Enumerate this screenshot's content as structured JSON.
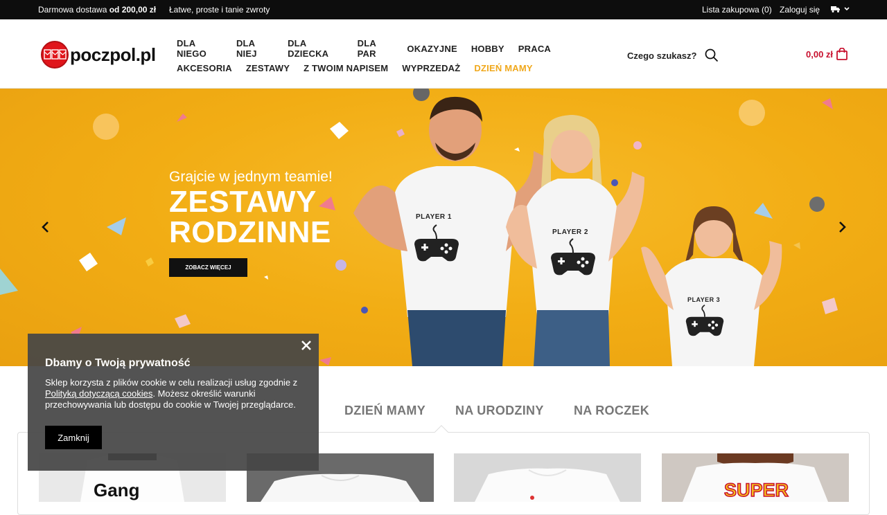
{
  "topbar": {
    "shipping_prefix": "Darmowa dostawa ",
    "shipping_amount": "od 200,00 zł",
    "returns": "Łatwe, proste i tanie zwroty",
    "wishlist": "Lista zakupowa (0)",
    "login": "Zaloguj się",
    "shipping_icon": "truck-icon"
  },
  "header": {
    "logo_text": "poczpol.pl",
    "search_label": "Czego szukasz?",
    "cart_total": "0,00 zł"
  },
  "nav": {
    "row1": [
      "DLA NIEGO",
      "DLA NIEJ",
      "DLA DZIECKA",
      "DLA PAR",
      "OKAZYJNE",
      "HOBBY",
      "PRACA"
    ],
    "row2": [
      "AKCESORIA",
      "ZESTAWY",
      "Z TWOIM NAPISEM",
      "WYPRZEDAŻ",
      "DZIEŃ MAMY"
    ]
  },
  "hero": {
    "subtitle": "Grajcie w jednym teamie!",
    "title_line1": "ZESTAWY",
    "title_line2": "RODZINNE",
    "button": "ZOBACZ WIĘCEJ",
    "shirts": [
      "PLAYER 1",
      "PLAYER 2",
      "PLAYER 3"
    ]
  },
  "tabs": [
    "DZIEŃ MAMY",
    "NA URODZINY",
    "NA ROCZEK"
  ],
  "products": [
    {
      "text": "Gang"
    },
    {
      "text": ""
    },
    {
      "text": ""
    },
    {
      "text": "SUPER"
    }
  ],
  "cookie": {
    "title": "Dbamy o Twoją prywatność",
    "text_before": "Sklep korzysta z plików cookie w celu realizacji usług zgodnie z ",
    "link": "Polityką dotyczącą cookies",
    "text_after": ". Możesz określić warunki przechowywania lub dostępu do cookie w Twojej przeglądarce.",
    "button": "Zamknij"
  },
  "colors": {
    "accent": "#f0a81c",
    "price": "#c8102e",
    "hero_bg": "#f2ad14",
    "logo_red": "#e0151b"
  }
}
